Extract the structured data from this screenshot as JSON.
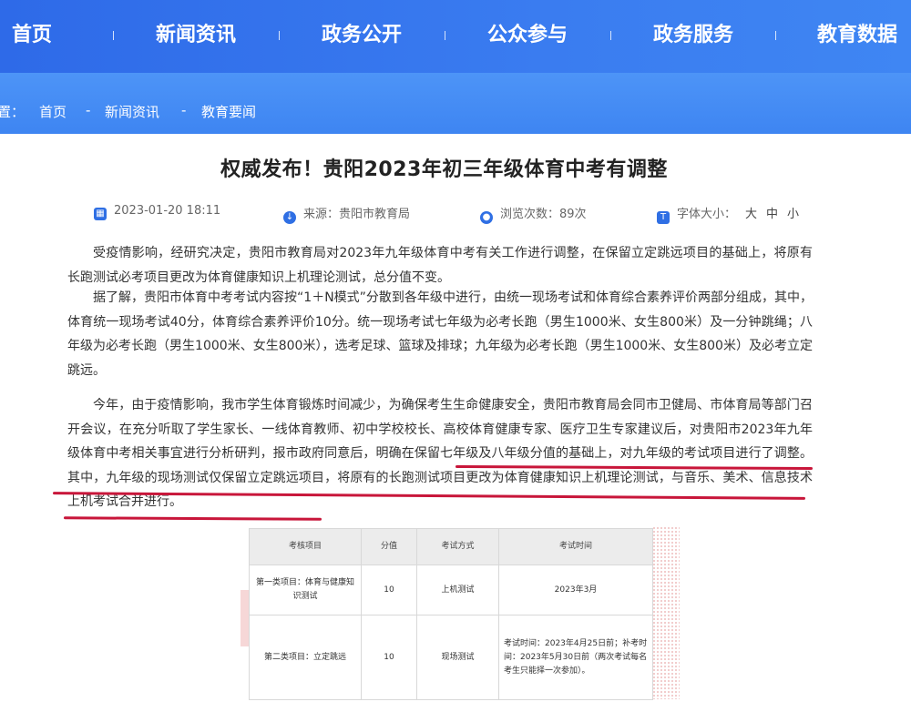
{
  "nav": {
    "items": [
      "首页",
      "新闻资讯",
      "政务公开",
      "公众参与",
      "政务服务",
      "教育数据"
    ]
  },
  "breadcrumb": {
    "prefix": "位置：",
    "items": [
      "首页",
      "新闻资讯",
      "教育要闻"
    ],
    "separator": "-"
  },
  "article": {
    "title": "权威发布！贵阳2023年初三年级体育中考有调整",
    "meta": {
      "date": "2023-01-20 18:11",
      "source": "来源：贵阳市教育局",
      "views": "浏览次数：89次",
      "font_size_label": "字体大小：",
      "font_size_options": [
        "大",
        "中",
        "小"
      ]
    },
    "paragraphs": [
      "受疫情影响，经研究决定，贵阳市教育局对2023年九年级体育中考有关工作进行调整，在保留立定跳远项目的基础上，将原有长跑测试必考项目更改为体育健康知识上机理论测试，总分值不变。",
      "据了解，贵阳市体育中考考试内容按“1＋N模式”分散到各年级中进行，由统一现场考试和体育综合素养评价两部分组成，其中，体育统一现场考试40分，体育综合素养评价10分。统一现场考试七年级为必考长跑（男生1000米、女生800米）及一分钟跳绳；八年级为必考长跑（男生1000米、女生800米），选考足球、篮球及排球；九年级为必考长跑（男生1000米、女生800米）及必考立定跳远。",
      "今年，由于疫情影响，我市学生体育锻炼时间减少，为确保考生生命健康安全，贵阳市教育局会同市卫健局、市体育局等部门召开会议，在充分听取了学生家长、一线体育教师、初中学校校长、高校体育健康专家、医疗卫生专家建议后，对贵阳市2023年九年级体育中考相关事宜进行分析研判，报市政府同意后，明确在保留七年级及八年级分值的基础上，对九年级的考试项目进行了调整。其中，九年级的现场测试仅保留立定跳远项目，将原有的长跑测试项目更改为体育健康知识上机理论测试，与音乐、美术、信息技术上机考试合并进行。"
    ]
  },
  "exam_table": {
    "headers": [
      "考核项目",
      "分值",
      "考试方式",
      "考试时间"
    ],
    "rows": [
      [
        "第一类项目：体育与健康知识测试",
        "10",
        "上机测试",
        "2023年3月"
      ],
      [
        "第二类项目：立定跳远",
        "10",
        "现场测试",
        "考试时间：2023年4月25日前；补考时间：2023年5月30日前（两次考试每名考生只能择一次参加）。"
      ]
    ]
  },
  "colors": {
    "nav_bg": "#2e6ae8",
    "breadcrumb_bg": "#4d94f7",
    "highlight_underline": "#c8163a",
    "meta_icon": "#2f6fe4"
  },
  "icons": {
    "date": "calendar-icon",
    "source": "source-icon",
    "views": "eye-icon",
    "font_size": "text-size-icon"
  }
}
